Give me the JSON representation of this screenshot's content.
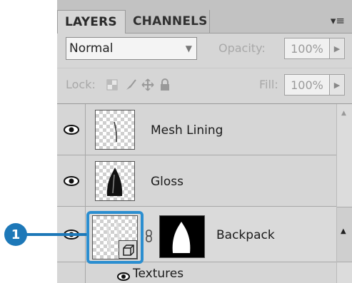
{
  "tabs": [
    {
      "label": "LAYERS",
      "active": true
    },
    {
      "label": "CHANNELS",
      "active": false
    }
  ],
  "blend_mode": "Normal",
  "opacity": {
    "label": "Opacity:",
    "value": "100%"
  },
  "lock": {
    "label": "Lock:"
  },
  "fill": {
    "label": "Fill:",
    "value": "100%"
  },
  "layers": [
    {
      "name": "Mesh Lining",
      "visible": true
    },
    {
      "name": "Gloss",
      "visible": true
    },
    {
      "name": "Backpack",
      "visible": true,
      "has_mask": true,
      "smart_object": true
    }
  ],
  "effects": {
    "label": "Textures"
  },
  "callout": {
    "number": "1",
    "color": "#1d78b8"
  }
}
